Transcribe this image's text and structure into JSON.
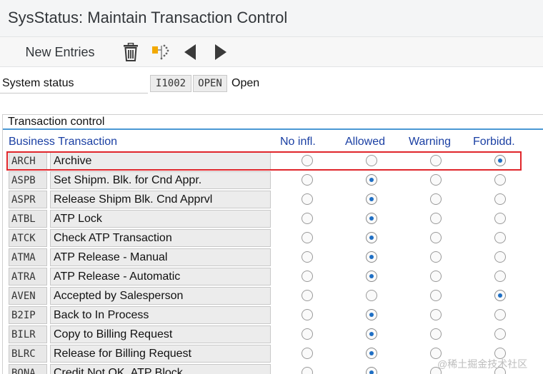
{
  "window": {
    "title": "SysStatus: Maintain Transaction Control"
  },
  "toolbar": {
    "new_entries_label": "New Entries",
    "icons": [
      "trash-icon",
      "select-block-icon",
      "previous-arrow-icon",
      "next-arrow-icon"
    ]
  },
  "system_status": {
    "label": "System status",
    "code": "I1002",
    "short": "OPEN",
    "text": "Open"
  },
  "transaction_control": {
    "title": "Transaction control",
    "columns": {
      "business_transaction": "Business Transaction",
      "no_infl": "No infl.",
      "allowed": "Allowed",
      "warning": "Warning",
      "forbidden": "Forbidd."
    },
    "options": [
      "no_infl",
      "allowed",
      "warning",
      "forbidden"
    ],
    "rows": [
      {
        "code": "ARCH",
        "desc": "Archive",
        "selected": "forbidden"
      },
      {
        "code": "ASPB",
        "desc": "Set Shipm. Blk. for Cnd  Appr.",
        "selected": "allowed"
      },
      {
        "code": "ASPR",
        "desc": "Release Shipm Blk. Cnd  Apprvl",
        "selected": "allowed"
      },
      {
        "code": "ATBL",
        "desc": "ATP Lock",
        "selected": "allowed"
      },
      {
        "code": "ATCK",
        "desc": "Check ATP Transaction",
        "selected": "allowed"
      },
      {
        "code": "ATMA",
        "desc": "ATP Release - Manual",
        "selected": "allowed"
      },
      {
        "code": "ATRA",
        "desc": "ATP Release - Automatic",
        "selected": "allowed"
      },
      {
        "code": "AVEN",
        "desc": "Accepted by Salesperson",
        "selected": "forbidden"
      },
      {
        "code": "B2IP",
        "desc": "Back to In Process",
        "selected": "allowed"
      },
      {
        "code": "BILR",
        "desc": "Copy to Billing Request",
        "selected": "allowed"
      },
      {
        "code": "BLRC",
        "desc": "Release for Billing Request",
        "selected": "allowed"
      },
      {
        "code": "BONA",
        "desc": "Credit Not OK, ATP Block",
        "selected": "allowed"
      }
    ]
  },
  "watermark": "@稀土掘金技术社区",
  "colors": {
    "accent": "#4a98d4",
    "header_text": "#1a3fa3",
    "highlight": "#e0262b",
    "radio_dot": "#1f6fc4"
  }
}
